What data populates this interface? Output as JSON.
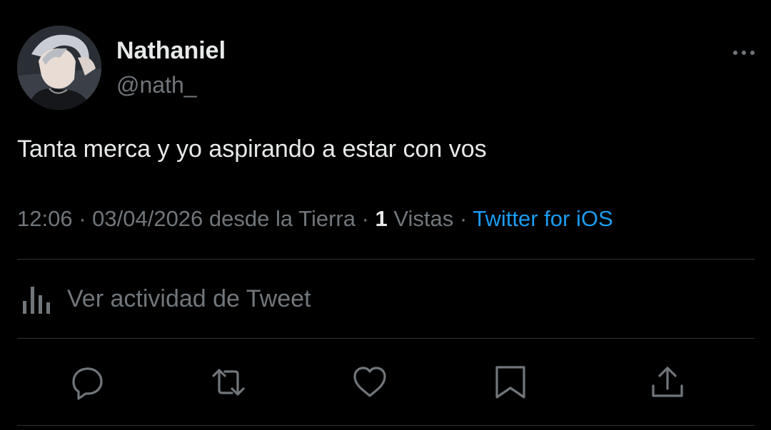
{
  "user": {
    "display_name": "Nathaniel",
    "handle": "@nath_"
  },
  "tweet": {
    "text": "Tanta merca y yo aspirando a estar con vos"
  },
  "meta": {
    "time": "12:06",
    "sep1": " · ",
    "date": "03/04/2026",
    "location": " desde la Tierra",
    "sep2": " · ",
    "views_count": "1",
    "views_label": " Vistas",
    "sep3": " · ",
    "source": "Twitter for iOS"
  },
  "activity": {
    "label": "Ver actividad de Tweet",
    "icon": "analytics-icon"
  },
  "actions": [
    {
      "icon": "reply-icon"
    },
    {
      "icon": "retweet-icon"
    },
    {
      "icon": "like-icon"
    },
    {
      "icon": "bookmark-icon"
    },
    {
      "icon": "share-icon"
    }
  ],
  "colors": {
    "background": "#000000",
    "text": "#e7e9ea",
    "muted": "#71767b",
    "link": "#1d9bf0",
    "divider": "#2f3336"
  }
}
